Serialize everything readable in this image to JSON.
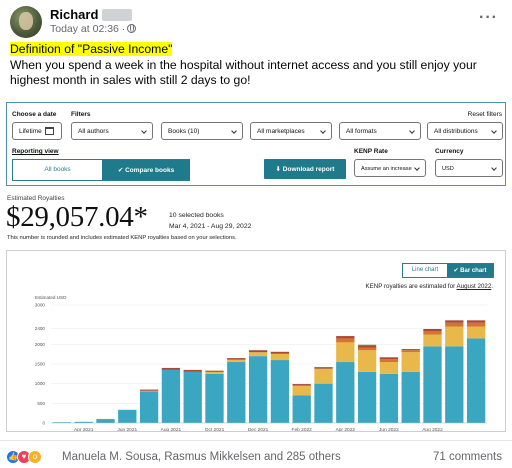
{
  "post": {
    "author": "Richard",
    "time": "Today at 02:36 ·",
    "headline": "Definition of \"Passive Income\"",
    "body": "When you spend a week in the hospital without internet access and you still enjoy your highest month in sales with still 2 days to go!"
  },
  "filters": {
    "choose_date_label": "Choose a date",
    "filters_label": "Filters",
    "reset_label": "Reset filters",
    "date_value": "Lifetime",
    "authors_value": "All authors",
    "books_value": "Books (10)",
    "marketplaces_value": "All marketplaces",
    "formats_value": "All formats",
    "distributions_value": "All distributions",
    "reporting_view_label": "Reporting view",
    "all_books_label": "All books",
    "compare_books_label": "✔ Compare books",
    "download_label": "⬇ Download report",
    "kenp_rate_label": "KENP Rate",
    "kenp_rate_value": "Assume an increase",
    "currency_label": "Currency",
    "currency_value": "USD"
  },
  "royalties": {
    "label": "Estimated Royalties",
    "amount": "$29,057.04*",
    "selected_books": "10 selected books",
    "date_range": "Mar 4, 2021 - Aug 29, 2022",
    "note": "This number is rounded and includes estimated KENP royalties based on your selections."
  },
  "chart_controls": {
    "line_chart_label": "Line chart",
    "bar_chart_label": "✔ Bar chart",
    "kenp_note_prefix": "KENP royalties are estimated for ",
    "kenp_note_month": "August 2022",
    "kenp_note_suffix": "."
  },
  "chart_data": {
    "type": "bar",
    "stacked": true,
    "ylabel": "Estimated USD",
    "ylim": [
      0,
      3000
    ],
    "yticks": [
      0,
      500,
      1000,
      1500,
      2000,
      2400,
      3000
    ],
    "x_tick_labels": [
      "Apr 2021",
      "Jun 2021",
      "Aug 2021",
      "Oct 2021",
      "Dec 2021",
      "Feb 2022",
      "Apr 2022",
      "Jun 2022",
      "Aug 2022"
    ],
    "x_tick_positions": [
      1.5,
      3.5,
      5.5,
      7.5,
      9.5,
      11.5,
      13.5,
      15.5,
      17.5
    ],
    "series": [
      {
        "color": "#3aa6c2",
        "values": [
          20,
          30,
          100,
          330,
          800,
          1350,
          1300,
          1250,
          1550,
          1700,
          1600,
          700,
          1000,
          1550,
          1300,
          1250,
          1300,
          1950,
          1950,
          2150
        ]
      },
      {
        "color": "#e8b84a",
        "values": [
          0,
          0,
          5,
          10,
          20,
          0,
          0,
          50,
          60,
          100,
          160,
          250,
          380,
          500,
          550,
          300,
          500,
          300,
          500,
          300
        ]
      },
      {
        "color": "#d6742a",
        "values": [
          0,
          0,
          0,
          0,
          0,
          0,
          0,
          0,
          0,
          0,
          0,
          0,
          0,
          100,
          70,
          70,
          50,
          80,
          100,
          100
        ]
      },
      {
        "color": "#a84a3a",
        "values": [
          0,
          0,
          0,
          0,
          30,
          50,
          50,
          30,
          40,
          50,
          50,
          40,
          40,
          60,
          50,
          50,
          30,
          60,
          60,
          60
        ]
      },
      {
        "color": "#7a9a4a",
        "values": [
          0,
          0,
          0,
          0,
          0,
          0,
          0,
          0,
          0,
          0,
          0,
          0,
          0,
          0,
          20,
          0,
          0,
          0,
          0,
          0
        ]
      }
    ]
  },
  "footer": {
    "reaction_names": "Manuela M. Sousa, Rasmus Mikkelsen and 285 others",
    "comments": "71 comments",
    "like_icon": "like-icon",
    "love_icon": "love-icon",
    "wow_icon": "wow-icon"
  }
}
